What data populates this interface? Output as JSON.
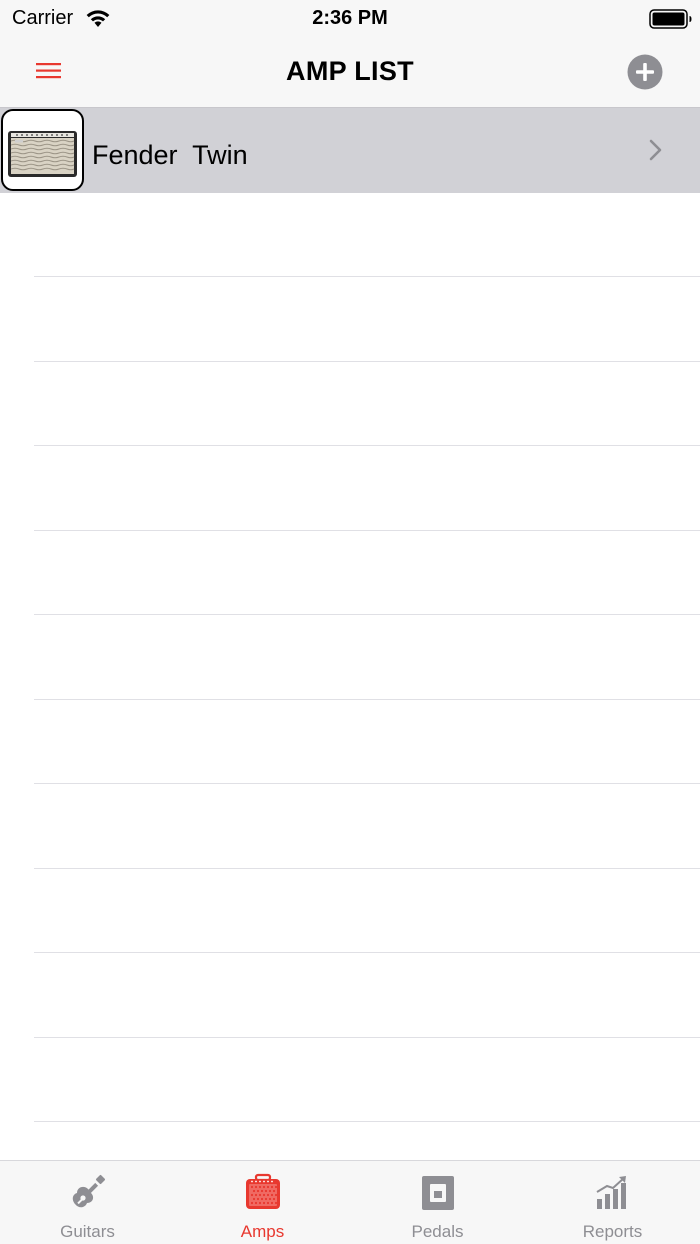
{
  "status_bar": {
    "carrier": "Carrier",
    "time": "2:36 PM",
    "icons": [
      "wifi-icon",
      "battery-icon"
    ]
  },
  "nav": {
    "title": "AMP LIST",
    "left_icon": "hamburger-menu-icon",
    "right_icon": "add-circle-icon",
    "accent_color": "#e8382f"
  },
  "amps": [
    {
      "name": "Fender  Twin",
      "selected": true,
      "icon": "amp-thumbnail-image"
    }
  ],
  "tabs": [
    {
      "label": "Guitars",
      "icon": "guitar-icon",
      "active": false
    },
    {
      "label": "Amps",
      "icon": "amp-icon",
      "active": true
    },
    {
      "label": "Pedals",
      "icon": "pedal-icon",
      "active": false
    },
    {
      "label": "Reports",
      "icon": "reports-chart-icon",
      "active": false
    }
  ],
  "colors": {
    "active_tab": "#e8382f",
    "inactive_tab": "#8e8e93",
    "selected_row": "#d1d1d6"
  }
}
